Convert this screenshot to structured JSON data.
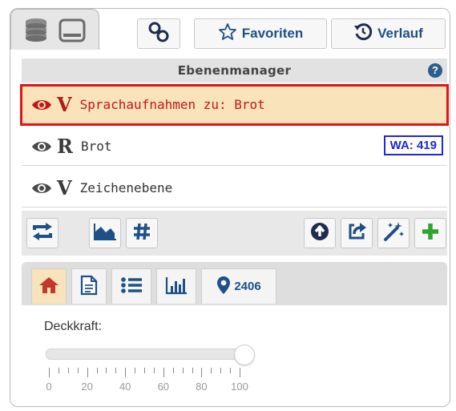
{
  "toolbar": {
    "favorites_label": "Favoriten",
    "history_label": "Verlauf",
    "layer_stack_icon": "database-stack-icon",
    "panel_icon": "window-minimize-icon",
    "link_icon": "link-icon"
  },
  "layer_manager": {
    "title": "Ebenenmanager",
    "help": "?"
  },
  "layers": [
    {
      "visibility": "eye-icon",
      "type": "V",
      "name": "Sprachaufnahmen zu: Brot",
      "selected": true
    },
    {
      "visibility": "eye-icon",
      "type": "R",
      "name": "Brot",
      "badge": "WA: 419"
    },
    {
      "visibility": "eye-icon",
      "type": "V",
      "name": "Zeichenebene"
    }
  ],
  "tools": {
    "left": [
      "swap-icon",
      "area-chart-icon",
      "grid-hash-icon"
    ],
    "right": [
      "up-arrow-circle-icon",
      "share-icon",
      "magic-wand-icon",
      "add-icon"
    ]
  },
  "tabs": {
    "items": [
      "home-icon",
      "document-icon",
      "list-icon",
      "bar-chart-icon"
    ],
    "marker_count": "2406"
  },
  "opacity": {
    "label": "Deckkraft:",
    "value_percent": 100,
    "scale": [
      "0",
      "20",
      "40",
      "60",
      "80",
      "100"
    ]
  },
  "colors": {
    "accent_blue": "#1e4f87",
    "selected_bg": "#f8e3bb",
    "selection_border": "#e0141a",
    "selected_text": "#c4161c",
    "badge_blue": "#1d28d8",
    "add_green": "#2fa52f",
    "home_red": "#c0392b"
  }
}
